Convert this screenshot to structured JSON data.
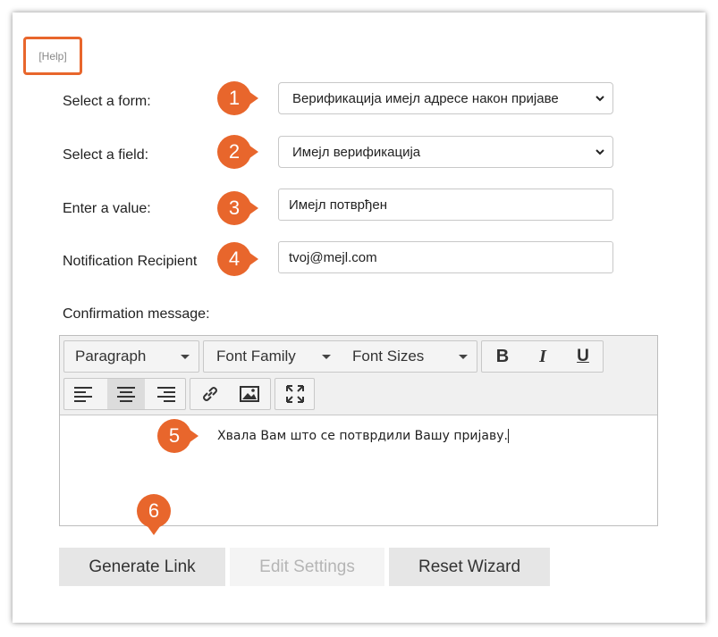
{
  "help_link": "[Help]",
  "form_rows": [
    {
      "label": "Select a form:",
      "value": "Верификација имејл адресе након пријаве",
      "badge": "1"
    },
    {
      "label": "Select a field:",
      "value": "Имејл верификација",
      "badge": "2"
    },
    {
      "label": "Enter a value:",
      "value": "Имејл потврђен",
      "badge": "3"
    },
    {
      "label": "Notification Recipient",
      "value": "tvoj@mejl.com",
      "badge": "4"
    }
  ],
  "confirmation_label": "Confirmation message:",
  "toolbar": {
    "paragraph": "Paragraph",
    "font_family": "Font Family",
    "font_sizes": "Font Sizes",
    "bold": "B",
    "italic": "I",
    "underline": "U"
  },
  "editor_content": "Хвала Вам што се потврдили Вашу пријаву.",
  "badges": {
    "editor": "5",
    "generate": "6"
  },
  "buttons": {
    "generate": "Generate Link",
    "edit": "Edit Settings",
    "reset": "Reset Wizard"
  },
  "colors": {
    "accent": "#e8662c"
  }
}
